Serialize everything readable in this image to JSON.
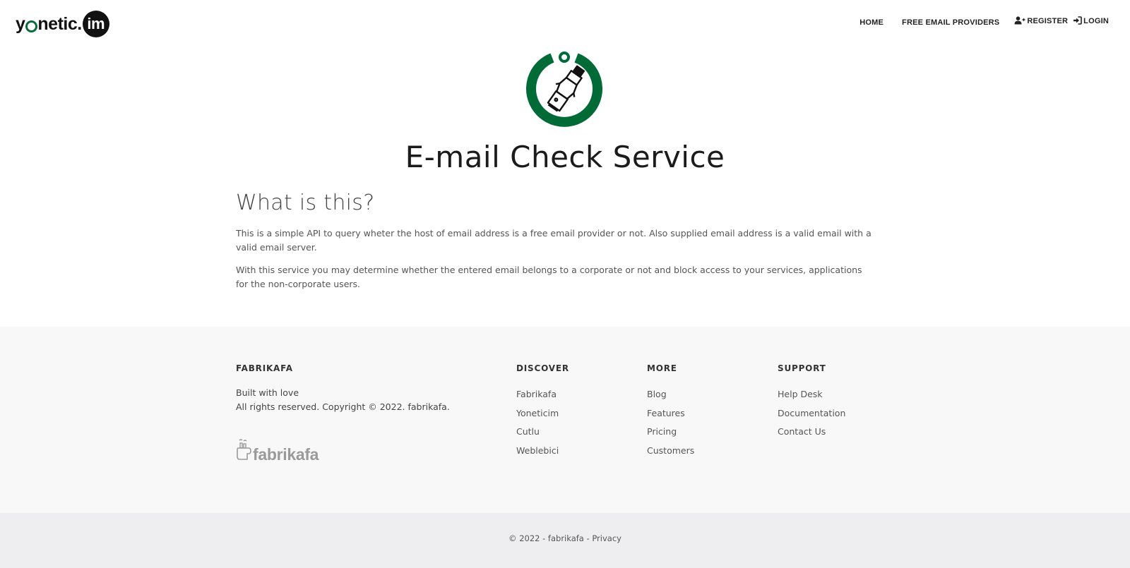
{
  "brand": {
    "logo_text_prefix": "y",
    "logo_text_suffix": "netic.",
    "logo_badge": "im",
    "accent_color": "#0a6b3a"
  },
  "nav": {
    "home": "HOME",
    "free_email_providers": "FREE EMAIL PROVIDERS",
    "register": "REGISTER",
    "login": "LOGIN",
    "register_icon": "user-plus-icon",
    "login_icon": "sign-in-icon"
  },
  "hero": {
    "icon": "usb-plug-power-icon",
    "title": "E-mail Check Service"
  },
  "content": {
    "heading": "What is this?",
    "paragraphs": [
      "This is a simple API to query wheter the host of email address is a free email provider or not. Also supplied email address is a valid email with a valid email server.",
      "With this service you may determine whether the entered email belongs to a corporate or not and block access to your services, applications for the non-corporate users."
    ]
  },
  "footer": {
    "brand": {
      "heading": "FABRIKAFA",
      "line1": "Built with love",
      "line2": "All rights reserved. Copyright © 2022. fabrikafa.",
      "logo_text": "fabrikafa"
    },
    "discover": {
      "heading": "DISCOVER",
      "items": [
        "Fabrikafa",
        "Yoneticim",
        "Cutlu",
        "Weblebici"
      ]
    },
    "more": {
      "heading": "MORE",
      "items": [
        "Blog",
        "Features",
        "Pricing",
        "Customers"
      ]
    },
    "support": {
      "heading": "SUPPORT",
      "items": [
        "Help Desk",
        "Documentation",
        "Contact Us"
      ]
    }
  },
  "bottom": {
    "copyright": "© 2022 - fabrikafa - ",
    "privacy": "Privacy"
  }
}
